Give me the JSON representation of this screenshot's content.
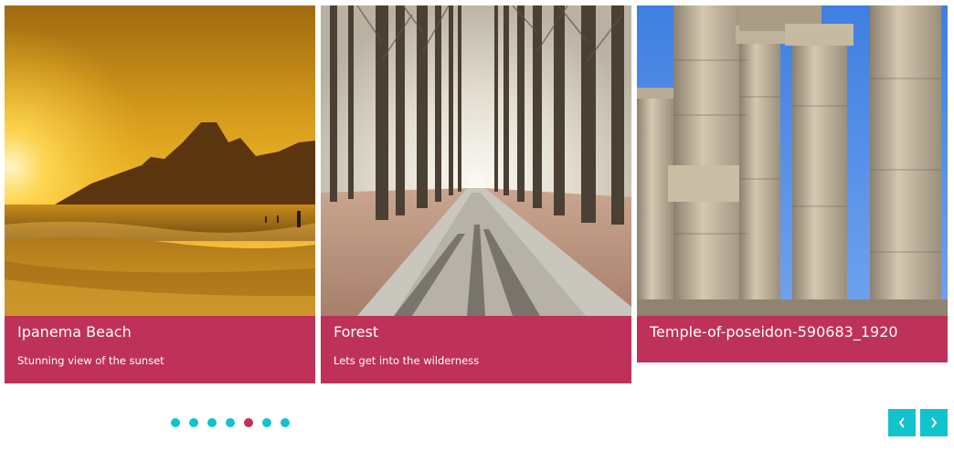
{
  "carousel": {
    "slides": [
      {
        "title": "Ipanema Beach",
        "subtitle": "Stunning view of the sunset",
        "image": "beach-sunset-photo"
      },
      {
        "title": "Forest",
        "subtitle": "Lets get into the wilderness",
        "image": "forest-road-photo"
      },
      {
        "title": "Temple-of-poseidon-590683_1920",
        "subtitle": "",
        "image": "temple-columns-photo"
      }
    ],
    "pagination": {
      "count": 7,
      "active_index": 5
    },
    "nav": {
      "prev_icon": "chevron-left-icon",
      "next_icon": "chevron-right-icon"
    }
  },
  "colors": {
    "accent": "#be3158",
    "teal": "#12c2cc"
  }
}
